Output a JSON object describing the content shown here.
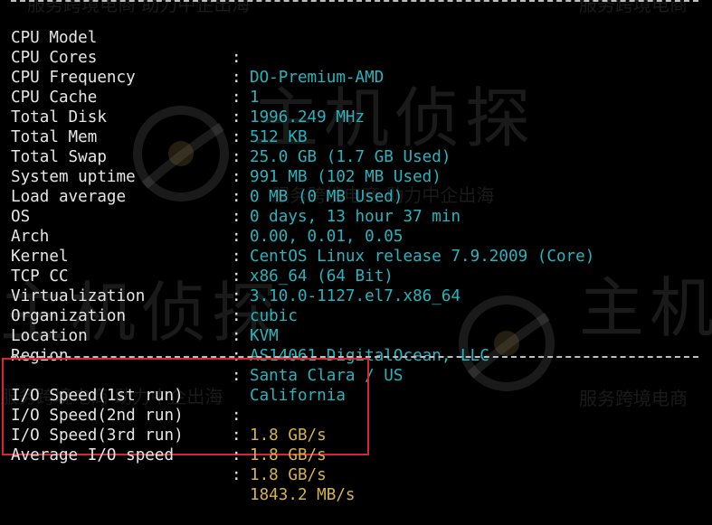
{
  "system_info": [
    {
      "label": "CPU Model",
      "value": "DO-Premium-AMD"
    },
    {
      "label": "CPU Cores",
      "value": "1"
    },
    {
      "label": "CPU Frequency",
      "value": "1996.249 MHz"
    },
    {
      "label": "CPU Cache",
      "value": "512 KB"
    },
    {
      "label": "Total Disk",
      "value": "25.0 GB (1.7 GB Used)"
    },
    {
      "label": "Total Mem",
      "value": "991 MB (102 MB Used)"
    },
    {
      "label": "Total Swap",
      "value": "0 MB (0 MB Used)"
    },
    {
      "label": "System uptime",
      "value": "0 days, 13 hour 37 min"
    },
    {
      "label": "Load average",
      "value": "0.00, 0.01, 0.05"
    },
    {
      "label": "OS",
      "value": "CentOS Linux release 7.9.2009 (Core)"
    },
    {
      "label": "Arch",
      "value": "x86_64 (64 Bit)"
    },
    {
      "label": "Kernel",
      "value": "3.10.0-1127.el7.x86_64"
    },
    {
      "label": "TCP CC",
      "value": "cubic"
    },
    {
      "label": "Virtualization",
      "value": "KVM"
    },
    {
      "label": "Organization",
      "value": "AS14061 DigitalOcean, LLC"
    },
    {
      "label": "Location",
      "value": "Santa Clara / US"
    },
    {
      "label": "Region",
      "value": "California"
    }
  ],
  "io_speed": [
    {
      "label": "I/O Speed(1st run)",
      "value": "1.8 GB/s"
    },
    {
      "label": "I/O Speed(2nd run)",
      "value": "1.8 GB/s"
    },
    {
      "label": "I/O Speed(3rd run)",
      "value": "1.8 GB/s"
    },
    {
      "label": "Average I/O speed",
      "value": "1843.2 MB/s"
    }
  ],
  "separator": ":",
  "watermark": {
    "brand_text": "主机侦探",
    "brand_text_short": "主机",
    "tagline": "服务跨境电商",
    "tagline_alt": "服务跨境电商 助力中企出海"
  },
  "colors": {
    "background": "#000000",
    "label": "#e6e6e6",
    "value": "#26b5bf",
    "io_value": "#d6b24a",
    "highlight_box": "#d8262c"
  }
}
